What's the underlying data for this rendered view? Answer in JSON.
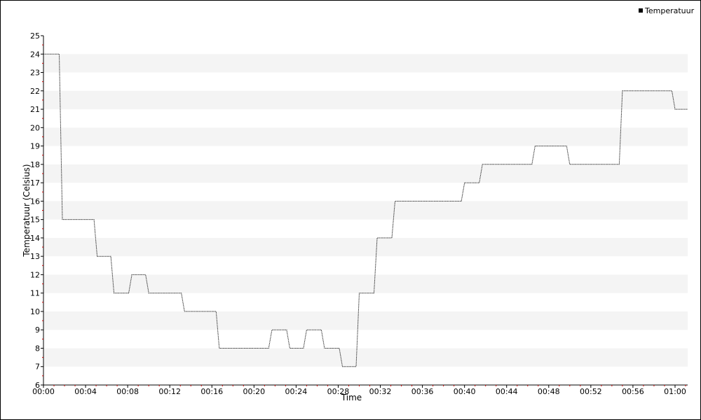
{
  "chart_data": {
    "type": "line",
    "step": true,
    "xlabel": "Time",
    "ylabel": "Temperatuur (Celsius)",
    "xlim_minutes": [
      0,
      61.2
    ],
    "ylim": [
      6,
      25
    ],
    "yticks": [
      6,
      7,
      8,
      9,
      10,
      11,
      12,
      13,
      14,
      15,
      16,
      17,
      18,
      19,
      20,
      21,
      22,
      23,
      24,
      25
    ],
    "xticks": [
      "00:00",
      "00:04",
      "00:08",
      "00:12",
      "00:16",
      "00:20",
      "00:24",
      "00:28",
      "00:32",
      "00:36",
      "00:40",
      "00:44",
      "00:48",
      "00:52",
      "00:56",
      "01:00"
    ],
    "grid": "alternating-horizontal-bands",
    "legend_position": "top-right",
    "colors": {
      "line": "#333333",
      "band": "#f4f4f4",
      "minor_tick": "#cc0000"
    },
    "series": [
      {
        "name": "Temperatuur",
        "points": [
          [
            "00:00",
            24
          ],
          [
            "00:01.5",
            24
          ],
          [
            "00:01.8",
            15
          ],
          [
            "00:04.8",
            15
          ],
          [
            "00:05.1",
            13
          ],
          [
            "00:06.4",
            13
          ],
          [
            "00:06.7",
            11
          ],
          [
            "00:08.1",
            11
          ],
          [
            "00:08.4",
            12
          ],
          [
            "00:09.7",
            12
          ],
          [
            "00:10.0",
            11
          ],
          [
            "00:13.1",
            11
          ],
          [
            "00:13.4",
            10
          ],
          [
            "00:16.4",
            10
          ],
          [
            "00:16.7",
            8
          ],
          [
            "00:21.4",
            8
          ],
          [
            "00:21.7",
            9
          ],
          [
            "00:23.1",
            9
          ],
          [
            "00:23.4",
            8
          ],
          [
            "00:24.7",
            8
          ],
          [
            "00:25.0",
            9
          ],
          [
            "00:26.4",
            9
          ],
          [
            "00:26.7",
            8
          ],
          [
            "00:28.1",
            8
          ],
          [
            "00:28.4",
            7
          ],
          [
            "00:29.7",
            7
          ],
          [
            "00:30.0",
            11
          ],
          [
            "00:31.4",
            11
          ],
          [
            "00:31.7",
            14
          ],
          [
            "00:33.1",
            14
          ],
          [
            "00:33.4",
            16
          ],
          [
            "00:39.7",
            16
          ],
          [
            "00:40.0",
            17
          ],
          [
            "00:41.4",
            17
          ],
          [
            "00:41.7",
            18
          ],
          [
            "00:46.4",
            18
          ],
          [
            "00:46.7",
            19
          ],
          [
            "00:49.7",
            19
          ],
          [
            "00:50.0",
            18
          ],
          [
            "00:54.7",
            18
          ],
          [
            "00:55.0",
            22
          ],
          [
            "00:59.7",
            22
          ],
          [
            "01:00.0",
            21
          ],
          [
            "01:01.2",
            21
          ]
        ]
      }
    ]
  }
}
